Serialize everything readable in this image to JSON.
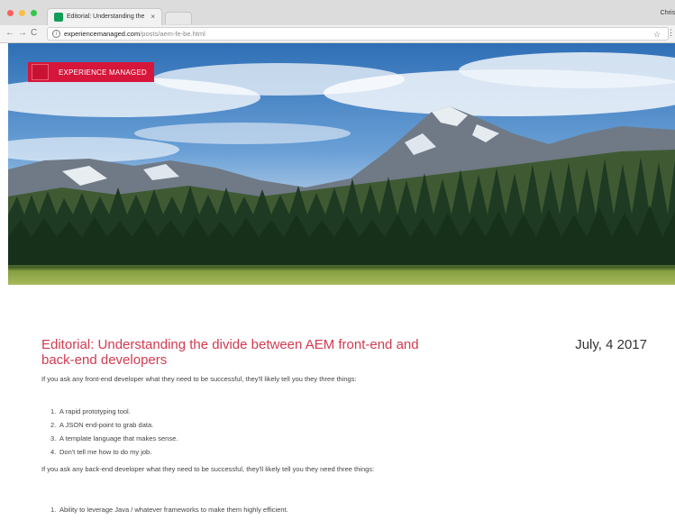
{
  "browser": {
    "tab_title": "Editorial: Understanding the d",
    "tab_close": "×",
    "profile_name": "Chris",
    "url_host": "experiencemanaged.com",
    "url_path": "/posts/aem-fe-be.html",
    "icons": [
      "back-arrow-icon",
      "forward-arrow-icon",
      "reload-icon",
      "info-icon",
      "star-icon",
      "menu-icon"
    ]
  },
  "site": {
    "logo_text": "EXPERIENCE MANAGED",
    "brand_color": "#d6163a"
  },
  "article": {
    "title": "Editorial: Understanding the divide between AEM front-end and back-end developers",
    "date": "July, 4 2017",
    "para1": "If you ask any front-end developer what they need to be successful, they'll likely tell you they three things:",
    "list1": [
      {
        "num": "1.",
        "text": "A rapid prototyping tool."
      },
      {
        "num": "2.",
        "text": "A JSON end-point to grab data."
      },
      {
        "num": "3.",
        "text": "A template language that makes sense."
      },
      {
        "num": "4.",
        "text": "Don't tell me how to do my job."
      }
    ],
    "para2": "If you ask any back-end developer what they need to be successful, they'll likely tell you they need three things:",
    "list2": [
      {
        "num": "1.",
        "text": "Ability to leverage Java / whatever frameworks to make them highly efficient."
      }
    ]
  }
}
